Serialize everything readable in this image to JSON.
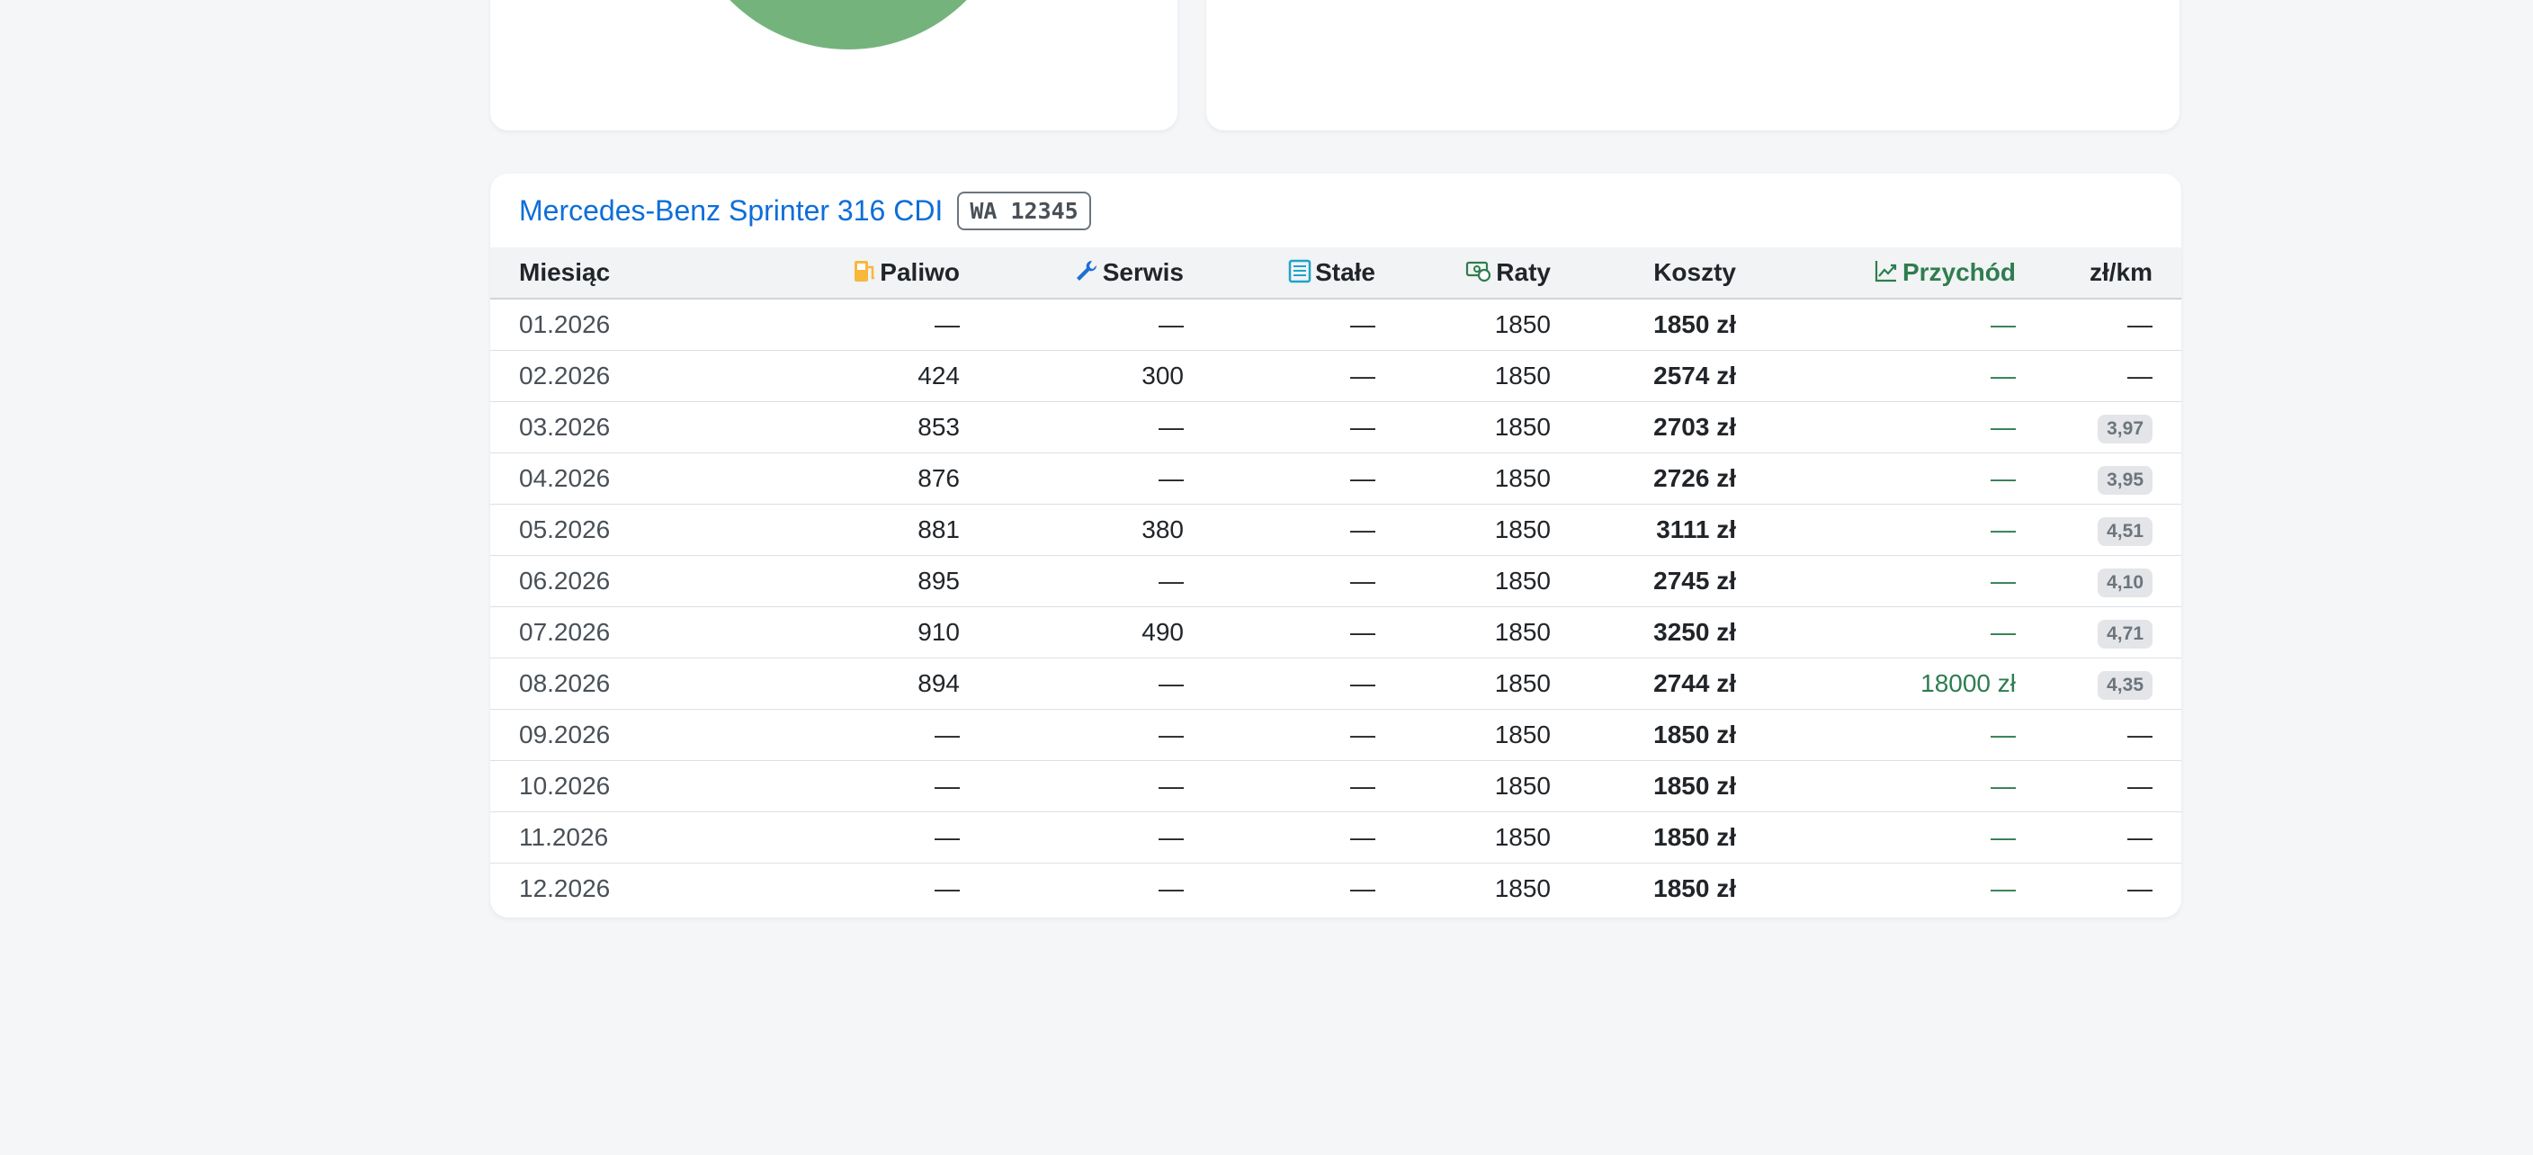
{
  "vehicle": {
    "name": "Mercedes-Benz Sprinter 316 CDI",
    "plate": "WA 12345"
  },
  "table": {
    "headers": {
      "month": "Miesiąc",
      "fuel": "Paliwo",
      "service": "Serwis",
      "fixed": "Stałe",
      "installments": "Raty",
      "costs": "Koszty",
      "income": "Przychód",
      "per_km": "zł/km"
    },
    "rows": [
      {
        "month": "01.2026",
        "fuel": "—",
        "service": "—",
        "fixed": "—",
        "installments": "1850",
        "costs": "1850 zł",
        "income": "—",
        "per_km": "—"
      },
      {
        "month": "02.2026",
        "fuel": "424",
        "service": "300",
        "fixed": "—",
        "installments": "1850",
        "costs": "2574 zł",
        "income": "—",
        "per_km": "—"
      },
      {
        "month": "03.2026",
        "fuel": "853",
        "service": "—",
        "fixed": "—",
        "installments": "1850",
        "costs": "2703 zł",
        "income": "—",
        "per_km": "3,97"
      },
      {
        "month": "04.2026",
        "fuel": "876",
        "service": "—",
        "fixed": "—",
        "installments": "1850",
        "costs": "2726 zł",
        "income": "—",
        "per_km": "3,95"
      },
      {
        "month": "05.2026",
        "fuel": "881",
        "service": "380",
        "fixed": "—",
        "installments": "1850",
        "costs": "3111 zł",
        "income": "—",
        "per_km": "4,51"
      },
      {
        "month": "06.2026",
        "fuel": "895",
        "service": "—",
        "fixed": "—",
        "installments": "1850",
        "costs": "2745 zł",
        "income": "—",
        "per_km": "4,10"
      },
      {
        "month": "07.2026",
        "fuel": "910",
        "service": "490",
        "fixed": "—",
        "installments": "1850",
        "costs": "3250 zł",
        "income": "—",
        "per_km": "4,71"
      },
      {
        "month": "08.2026",
        "fuel": "894",
        "service": "—",
        "fixed": "—",
        "installments": "1850",
        "costs": "2744 zł",
        "income": "18000 zł",
        "per_km": "4,35"
      },
      {
        "month": "09.2026",
        "fuel": "—",
        "service": "—",
        "fixed": "—",
        "installments": "1850",
        "costs": "1850 zł",
        "income": "—",
        "per_km": "—"
      },
      {
        "month": "10.2026",
        "fuel": "—",
        "service": "—",
        "fixed": "—",
        "installments": "1850",
        "costs": "1850 zł",
        "income": "—",
        "per_km": "—"
      },
      {
        "month": "11.2026",
        "fuel": "—",
        "service": "—",
        "fixed": "—",
        "installments": "1850",
        "costs": "1850 zł",
        "income": "—",
        "per_km": "—"
      },
      {
        "month": "12.2026",
        "fuel": "—",
        "service": "—",
        "fixed": "—",
        "installments": "1850",
        "costs": "1850 zł",
        "income": "—",
        "per_km": "—"
      }
    ]
  },
  "icons": {
    "fuel": "fuel-pump-icon",
    "service": "wrench-icon",
    "fixed": "list-document-icon",
    "installments": "cash-coin-icon",
    "income": "trend-up-icon"
  },
  "colors": {
    "title": "#0d6ed8",
    "income": "#2e7d4f",
    "donut": "#74b47c"
  }
}
